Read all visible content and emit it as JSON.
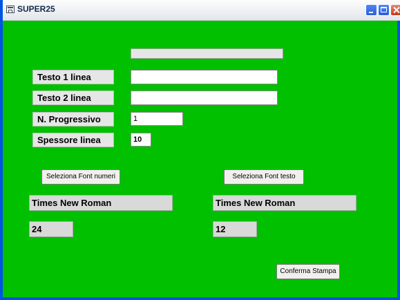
{
  "window": {
    "title": "SUPER25",
    "background_color": "#00c000"
  },
  "form": {
    "progress": {
      "value": 0
    },
    "line1_label": "Testo 1 linea",
    "line1_value": "",
    "line2_label": "Testo 2 linea",
    "line2_value": "",
    "progressive_label": "N. Progressivo",
    "progressive_value": "1",
    "thickness_label": "Spessore linea",
    "thickness_value": "10"
  },
  "fonts": {
    "numbers_button": "Seleziona Font numeri",
    "text_button": "Seleziona Font testo",
    "numbers_font_name": "Times New Roman",
    "text_font_name": "Times New Roman",
    "numbers_font_size": "24",
    "text_font_size": "12"
  },
  "actions": {
    "confirm_print": "Conferma Stampa"
  }
}
